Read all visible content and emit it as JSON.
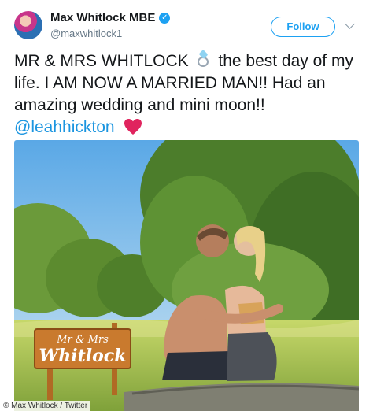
{
  "header": {
    "display_name": "Max Whitlock MBE",
    "verified_mark": "✓",
    "handle": "@maxwhitlock1",
    "follow_label": "Follow"
  },
  "tweet": {
    "text_part1": "MR & MRS WHITLOCK",
    "text_part2": " the best day of my life. I AM NOW A MARRIED MAN!! Had an amazing wedding and mini moon!!",
    "mention": "@leahhickton",
    "icons": [
      "ring-icon",
      "heart-icon"
    ]
  },
  "photo": {
    "sign_text_line1": "Mr & Mrs",
    "sign_text_line2": "Whitlock",
    "credit": "© Max Whitlock / Twitter"
  },
  "colors": {
    "accent": "#1da1f2",
    "mention": "#1b95e0",
    "heart": "#e0245e"
  }
}
